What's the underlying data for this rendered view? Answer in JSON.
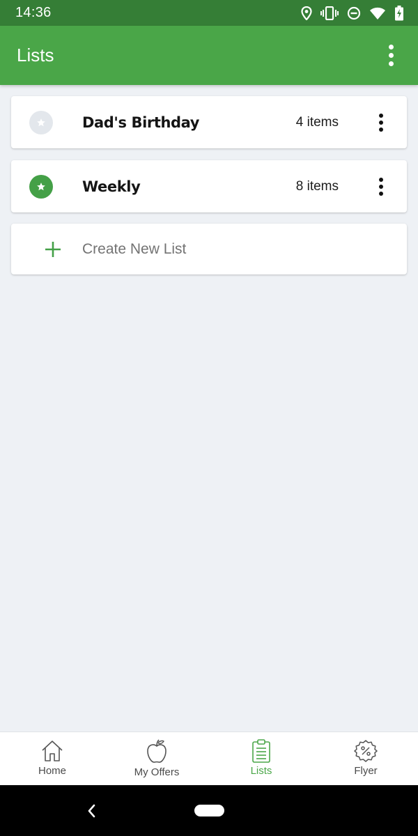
{
  "status_bar": {
    "time": "14:36"
  },
  "app_bar": {
    "title": "Lists"
  },
  "lists": [
    {
      "name": "Dad's Birthday",
      "count": "4 items",
      "starred": false
    },
    {
      "name": "Weekly",
      "count": "8 items",
      "starred": true
    }
  ],
  "create_new": {
    "label": "Create New List"
  },
  "bottom_nav": {
    "items": [
      {
        "label": "Home",
        "icon": "home-icon"
      },
      {
        "label": "My Offers",
        "icon": "apple-icon"
      },
      {
        "label": "Lists",
        "icon": "clipboard-list-icon",
        "active": true
      },
      {
        "label": "Flyer",
        "icon": "percent-badge-icon"
      }
    ]
  },
  "colors": {
    "status_bar": "#357e36",
    "app_bar": "#4aa648",
    "accent": "#44a047",
    "background": "#eef1f5"
  }
}
